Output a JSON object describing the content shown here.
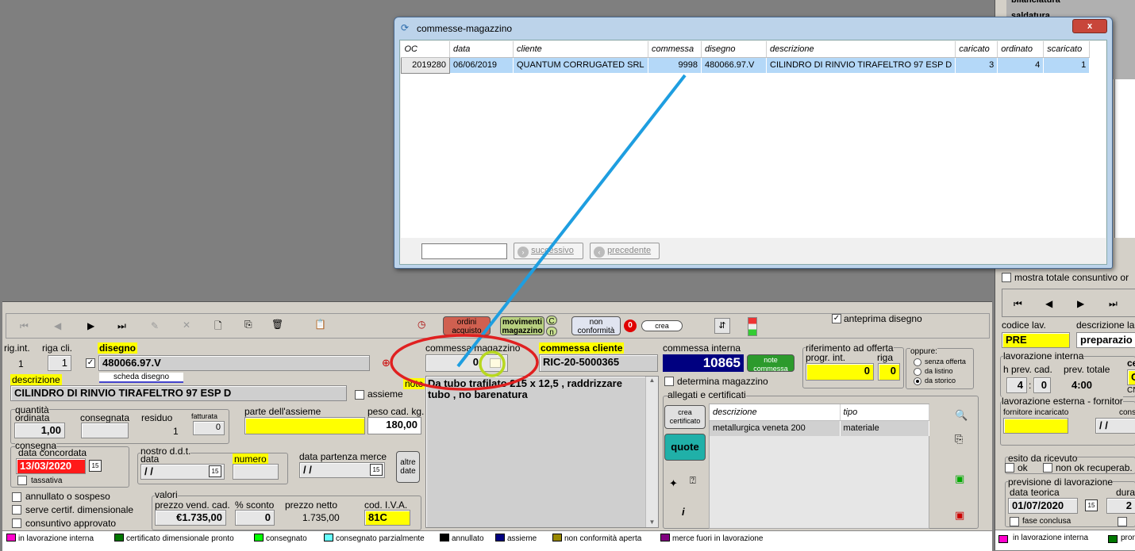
{
  "popup": {
    "title": "commesse-magazzino",
    "close_label": "x",
    "columns": [
      "OC",
      "data",
      "cliente",
      "commessa",
      "disegno",
      "descrizione",
      "caricato",
      "ordinato",
      "scaricato"
    ],
    "rows": [
      {
        "oc": "2019280",
        "data": "06/06/2019",
        "cliente": "QUANTUM CORRUGATED SRL",
        "commessa": "9998",
        "disegno": "480066.97.V",
        "descrizione": "CILINDRO DI RINVIO TIRAFELTRO 97 ESP D",
        "caricato": "3",
        "ordinato": "4",
        "scaricato": "1"
      }
    ],
    "next_label": "successivo",
    "prev_label": "precedente"
  },
  "right_bg": {
    "top_items": [
      "bilanciatura",
      "saldatura"
    ],
    "mostra_label": "mostra totale consuntivo or",
    "codice_lav_label": "codice lav.",
    "descrizione_lav_label": "descrizione la",
    "codice_lav_value": "PRE",
    "descrizione_lav_value": "preparazio",
    "lav_interna_label": "lavorazione interna",
    "h_prev_label": "h prev. cad.",
    "prev_totale_label": "prev. totale",
    "centr_label": "centr",
    "h_prev_value": "4",
    "h_prev_min": "0",
    "prev_totale_value": "4:00",
    "cnc_value": "CC_",
    "cnc_label": "CNC",
    "lav_esterna_label": "lavorazione esterna - fornitor",
    "fornitore_label": "fornitore incaricato",
    "cons_label": "cons",
    "cons_value": "/  /",
    "esito_label": "esito da ricevuto",
    "ok_label": "ok",
    "non_ok_label": "non ok recuperab.",
    "previsione_label": "previsione di lavorazione",
    "data_teorica_label": "data teorica",
    "durata_label": "durata",
    "data_teorica_value": "01/07/2020",
    "durata_value": "2",
    "fase_conclusa_label": "fase conclusa",
    "legend1": "in lavorazione interna",
    "legend2": "pron"
  },
  "toolbar": {
    "ordini_label": "ordini acquisto",
    "movimenti_label": "movimenti magazzino",
    "c_label": "C",
    "n_label": "n",
    "non_conf_label": "non conformità",
    "zero_badge": "0",
    "crea_label": "crea",
    "anteprima_label": "anteprima disegno"
  },
  "form": {
    "rig_int_label": "rig.int.",
    "riga_cli_label": "riga cli.",
    "rig_int_value": "1",
    "riga_cli_value": "1",
    "disegno_label": "disegno",
    "disegno_value": "480066.97.V",
    "scheda_label": "scheda disegno",
    "descrizione_label": "descrizione",
    "descrizione_value": "CILINDRO DI RINVIO TIRAFELTRO 97 ESP D",
    "assieme_label": "assieme",
    "quantita_label": "quantità",
    "ordinata_label": "ordinata",
    "consegnata_label": "consegnata",
    "residuo_label": "residuo",
    "fatturata_label": "fatturata",
    "ordinata_value": "1,00",
    "residuo_value": "1",
    "fatturata_value": "0",
    "parte_label": "parte dell'assieme",
    "peso_label": "peso cad. kg.",
    "peso_value": "180,00",
    "consegna_label": "consegna",
    "data_concordata_label": "data concordata",
    "data_concordata_value": "13/03/2020",
    "tassativa_label": "tassativa",
    "ddt_label": "nostro d.d.t.",
    "ddt_data_label": "data",
    "ddt_numero_label": "numero",
    "ddt_data_value": "/  /",
    "partenza_label": "data partenza merce",
    "partenza_value": "/  /",
    "altre_date_label": "altre date",
    "annullato_label": "annullato o sospeso",
    "serve_cert_label": "serve certif. dimensionale",
    "consuntivo_label": "consuntivo approvato",
    "valori_label": "valori",
    "prezzo_vend_label": "prezzo vend. cad.",
    "sconto_label": "% sconto",
    "prezzo_netto_label": "prezzo netto",
    "iva_label": "cod. I.V.A.",
    "prezzo_vend_value": "€1.735,00",
    "sconto_value": "0",
    "prezzo_netto_value": "1.735,00",
    "iva_value": "81C",
    "commessa_mag_label": "commessa magazzino",
    "commessa_mag_value": "0",
    "commessa_cli_label": "commessa cliente",
    "commessa_cli_value": "RIC-20-5000365",
    "note_label": "note",
    "note_value": "Da tubo trafilato 215 x 12,5 , raddrizzare tubo , no barenatura",
    "commessa_int_label": "commessa interna",
    "commessa_int_value": "10865",
    "note_commessa_label": "note commessa",
    "determina_label": "determina magazzino",
    "rif_offerta_label": "riferimento ad offerta",
    "progr_int_label": "progr. int.",
    "riga_label": "riga",
    "progr_int_value": "0",
    "riga_value": "0",
    "oppure_label": "oppure:",
    "senza_offerta_label": "senza offerta",
    "da_listino_label": "da listino",
    "da_storico_label": "da storico",
    "allegati_label": "allegati e certificati",
    "crea_cert_label": "crea certificato",
    "quote_label": "quote",
    "allegati_cols": [
      "descrizione",
      "tipo"
    ],
    "allegati_rows": [
      {
        "descrizione": "metallurgica veneta 200",
        "tipo": "materiale"
      }
    ]
  },
  "legend": [
    {
      "label": "in lavorazione interna",
      "color": "#ff00cc"
    },
    {
      "label": "certificato dimensionale pronto",
      "color": "#007700"
    },
    {
      "label": "consegnato",
      "color": "#00ff00"
    },
    {
      "label": "consegnato parzialmente",
      "color": "#66ffff"
    },
    {
      "label": "annullato",
      "color": "#000000"
    },
    {
      "label": "assieme",
      "color": "#000080"
    },
    {
      "label": "non conformità aperta",
      "color": "#998800"
    },
    {
      "label": "merce fuori in lavorazione",
      "color": "#800080"
    }
  ]
}
